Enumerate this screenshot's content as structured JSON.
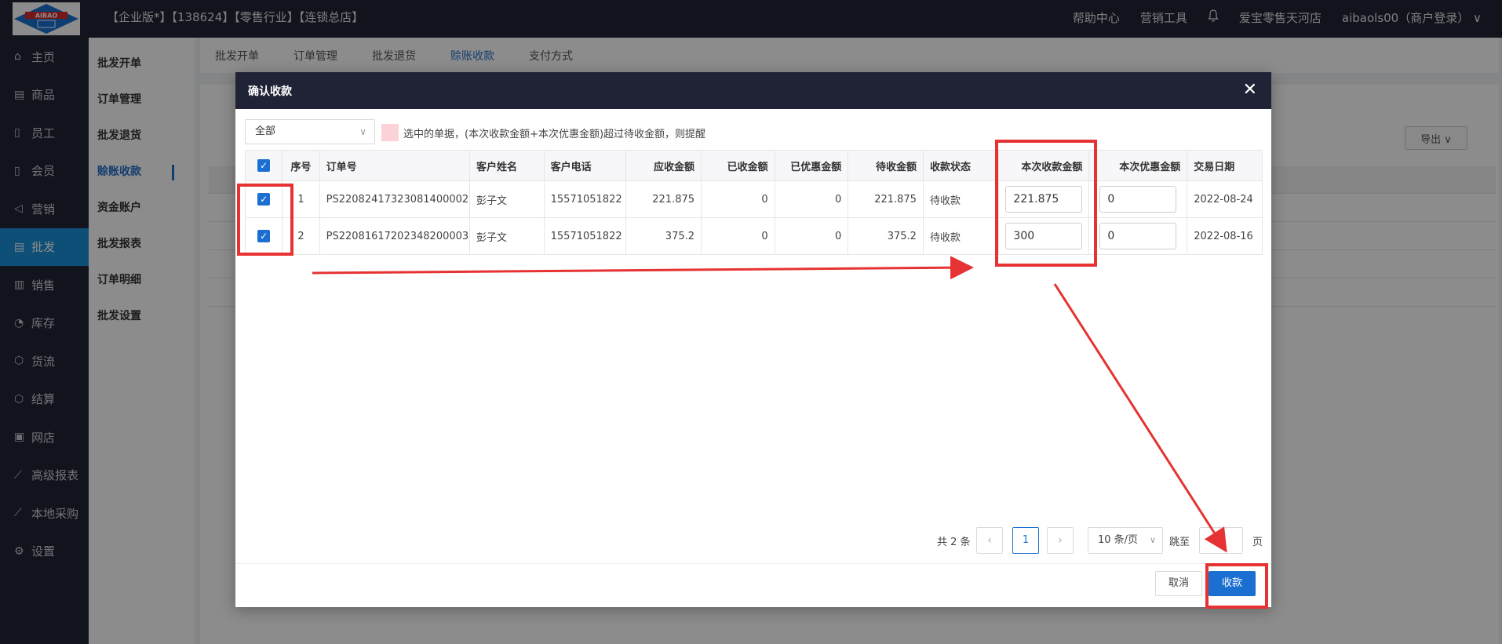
{
  "topbar": {
    "logo_text": "AIBAO",
    "title": "【企业版*】【138624】【零售行业】【连锁总店】",
    "help": "帮助中心",
    "marketing": "营销工具",
    "store": "爱宝零售天河店",
    "user": "aibaols00（商户登录）",
    "user_chevron": "∨"
  },
  "sidebar": {
    "items": [
      {
        "icon": "home-icon",
        "glyph": "⌂",
        "label": "主页"
      },
      {
        "icon": "goods-icon",
        "glyph": "▤",
        "label": "商品"
      },
      {
        "icon": "staff-icon",
        "glyph": "▯",
        "label": "员工"
      },
      {
        "icon": "member-icon",
        "glyph": "▯",
        "label": "会员"
      },
      {
        "icon": "megaphone-icon",
        "glyph": "◁",
        "label": "营销"
      },
      {
        "icon": "wholesale-icon",
        "glyph": "▤",
        "label": "批发"
      },
      {
        "icon": "chart-bar-icon",
        "glyph": "▥",
        "label": "销售"
      },
      {
        "icon": "pie-icon",
        "glyph": "◔",
        "label": "库存"
      },
      {
        "icon": "cube-icon",
        "glyph": "⬡",
        "label": "货流"
      },
      {
        "icon": "settle-icon",
        "glyph": "⬡",
        "label": "结算"
      },
      {
        "icon": "gift-icon",
        "glyph": "▣",
        "label": "网店"
      },
      {
        "icon": "line-chart-icon",
        "glyph": "⟋",
        "label": "高级报表"
      },
      {
        "icon": "purchase-icon",
        "glyph": "⟋",
        "label": "本地采购"
      },
      {
        "icon": "gear-icon",
        "glyph": "⚙",
        "label": "设置"
      }
    ]
  },
  "subnav": {
    "items": [
      "批发开单",
      "订单管理",
      "批发退货",
      "赊账收款",
      "资金账户",
      "批发报表",
      "订单明细",
      "批发设置"
    ]
  },
  "page": {
    "tabs": [
      "批发开单",
      "订单管理",
      "批发退货",
      "赊账收款",
      "支付方式"
    ],
    "export": "导出 ∨"
  },
  "modal": {
    "title": "确认收款",
    "close": "✕",
    "filter_value": "全部",
    "legend": "选中的单据，(本次收款金额+本次优惠金额)超过待收金额，则提醒",
    "columns": [
      "序号",
      "订单号",
      "客户姓名",
      "客户电话",
      "应收金额",
      "已收金额",
      "已优惠金额",
      "待收金额",
      "收款状态",
      "本次收款金额",
      "本次优惠金额",
      "交易日期"
    ],
    "rows": [
      {
        "no": "1",
        "order": "PS22082417323081400002",
        "name": "彭子文",
        "phone": "15571051822",
        "receivable": "221.875",
        "received": "0",
        "discounted": "0",
        "pending": "221.875",
        "status": "待收款",
        "pay_now": "221.875",
        "discount_now": "0",
        "date": "2022-08-24"
      },
      {
        "no": "2",
        "order": "PS22081617202348200003",
        "name": "彭子文",
        "phone": "15571051822",
        "receivable": "375.2",
        "received": "0",
        "discounted": "0",
        "pending": "375.2",
        "status": "待收款",
        "pay_now": "300",
        "discount_now": "0",
        "date": "2022-08-16"
      }
    ],
    "pager": {
      "total": "共 2 条",
      "prev": "‹",
      "current": "1",
      "next": "›",
      "size": "10 条/页",
      "jump": "跳至",
      "unit": "页"
    },
    "cancel": "取消",
    "confirm": "收款"
  },
  "colors": {
    "accent": "#1a6fd0",
    "nav_bg": "#1f2335",
    "annotation": "#e63232",
    "warn_swatch": "#fbd3d6"
  }
}
